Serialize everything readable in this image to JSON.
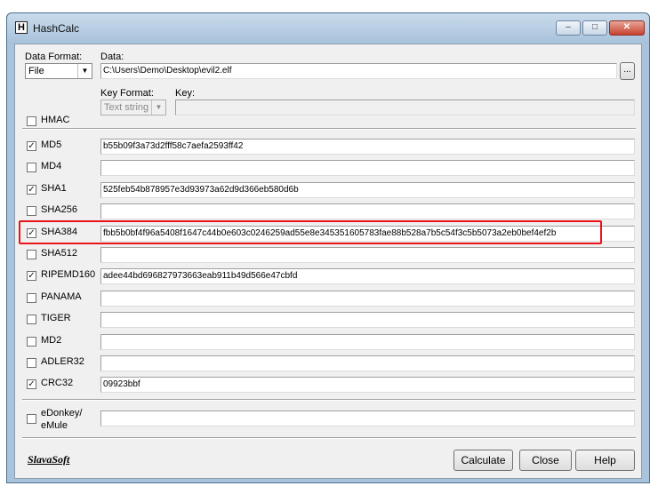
{
  "window": {
    "title": "HashCalc",
    "icon_letter": "H",
    "controls": {
      "minimize": "–",
      "maximize": "□",
      "close": "✕"
    }
  },
  "data_section": {
    "data_format_label": "Data Format:",
    "data_format_value": "File",
    "data_label": "Data:",
    "data_value": "C:\\Users\\Demo\\Desktop\\evil2.elf",
    "browse_label": "..."
  },
  "hmac": {
    "label": "HMAC",
    "checked": false,
    "key_format_label": "Key Format:",
    "key_format_value": "Text string",
    "key_label": "Key:",
    "key_value": ""
  },
  "hashes": [
    {
      "name": "MD5",
      "checked": true,
      "value": "b55b09f3a73d2fff58c7aefa2593ff42"
    },
    {
      "name": "MD4",
      "checked": false,
      "value": ""
    },
    {
      "name": "SHA1",
      "checked": true,
      "value": "525feb54b878957e3d93973a62d9d366eb580d6b"
    },
    {
      "name": "SHA256",
      "checked": false,
      "value": ""
    },
    {
      "name": "SHA384",
      "checked": true,
      "value": "fbb5b0bf4f96a5408f1647c44b0e603c0246259ad55e8e345351605783fae88b528a7b5c54f3c5b5073a2eb0bef4ef2b"
    },
    {
      "name": "SHA512",
      "checked": false,
      "value": ""
    },
    {
      "name": "RIPEMD160",
      "checked": true,
      "value": "adee44bd696827973663eab911b49d566e47cbfd"
    },
    {
      "name": "PANAMA",
      "checked": false,
      "value": ""
    },
    {
      "name": "TIGER",
      "checked": false,
      "value": ""
    },
    {
      "name": "MD2",
      "checked": false,
      "value": ""
    },
    {
      "name": "ADLER32",
      "checked": false,
      "value": ""
    },
    {
      "name": "CRC32",
      "checked": true,
      "value": "09923bbf"
    }
  ],
  "edonkey": {
    "label_line1": "eDonkey/",
    "label_line2": "eMule",
    "checked": false,
    "value": ""
  },
  "footer": {
    "logo": "SlavaSoft",
    "calculate_label": "Calculate",
    "close_label": "Close",
    "help_label": "Help"
  },
  "check_glyph": "✓",
  "highlight_color": "#e8141a"
}
